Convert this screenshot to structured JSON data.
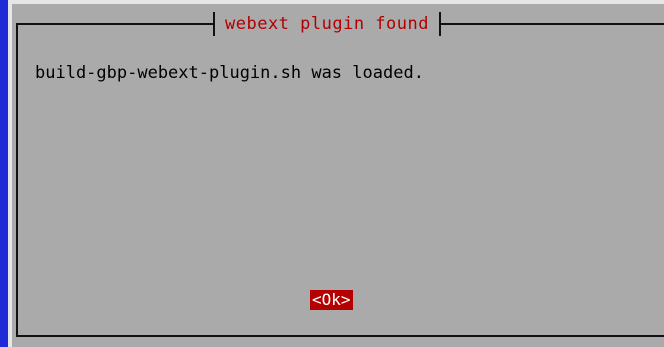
{
  "dialog": {
    "title": "webext plugin found",
    "message": "build-gbp-webext-plugin.sh was loaded.",
    "ok_label": "<Ok>"
  }
}
